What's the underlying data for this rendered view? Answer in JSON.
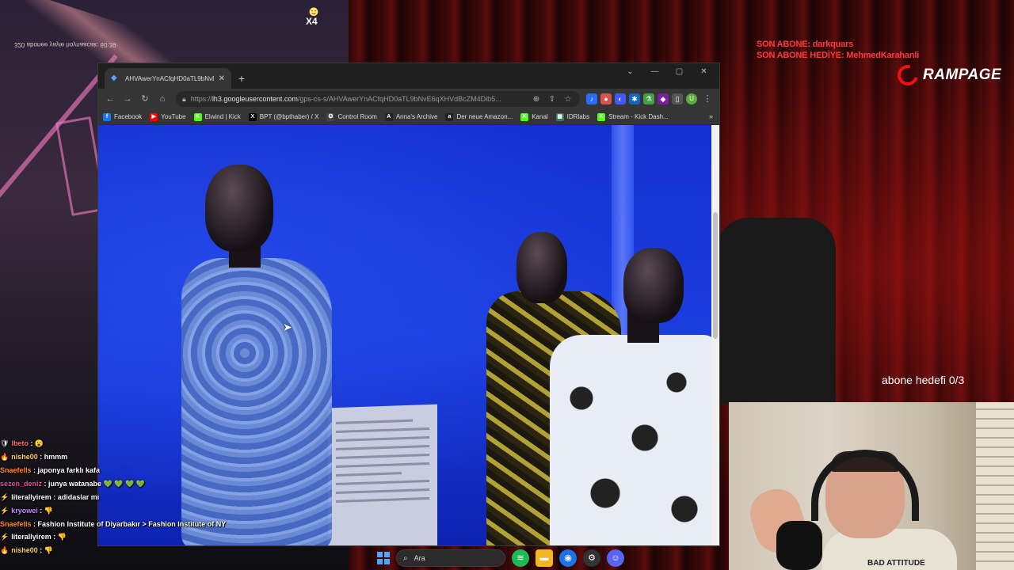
{
  "overlay": {
    "top_left_text": "320 abonee yayie hoynaacak: 60:39",
    "multiplier": "X4",
    "son_abone": "SON ABONE: darkquars",
    "son_abone_hediye": "SON ABONE HEDİYE: MehmedKarahanli",
    "brand": "RAMPAGE",
    "abone_hedefi": "abone hedefi 0/3",
    "shirt_text": "BAD ATTITUDE"
  },
  "browser": {
    "tab_title": "AHVAwerYnACfqHD0aTL9bNvE6...",
    "url_host": "lh3.googleusercontent.com",
    "url_path": "/gps-cs-s/AHVAwerYnACfqHD0aTL9bNvE6qXHVdBcZM4Dib5...",
    "url_scheme": "https://",
    "profile_initial": "U",
    "bookmarks": [
      {
        "label": "Facebook",
        "icon": "f",
        "color": "#1877f2"
      },
      {
        "label": "YouTube",
        "icon": "▶",
        "color": "#ff0000"
      },
      {
        "label": "Elwind | Kick",
        "icon": "K",
        "color": "#53fc18"
      },
      {
        "label": "BPT (@bpthaber) / X",
        "icon": "X",
        "color": "#000000"
      },
      {
        "label": "Control Room",
        "icon": "✪",
        "color": "#444444"
      },
      {
        "label": "Anna's Archive",
        "icon": "A",
        "color": "#222222"
      },
      {
        "label": "Der neue Amazon...",
        "icon": "a",
        "color": "#222222"
      },
      {
        "label": "Kanal",
        "icon": "K",
        "color": "#53fc18"
      },
      {
        "label": "IDRlabs",
        "icon": "▦",
        "color": "#3b7a57"
      },
      {
        "label": "Stream - Kick Dash...",
        "icon": "K",
        "color": "#53fc18"
      }
    ]
  },
  "chat": [
    {
      "user": "lbeto",
      "msg": " : 😮",
      "color": "#ff6f6f",
      "badge": "🛡"
    },
    {
      "user": "nishe00",
      "msg": " : hmmm",
      "color": "#ffd24a",
      "badge": "🔥"
    },
    {
      "user": "Snaefells",
      "msg": " : japonya farklı kafa",
      "color": "#ff8a1e",
      "badge": ""
    },
    {
      "user": "sezen_deniz",
      "msg": " : junya watanabe 💚 💚 💚 💚",
      "color": "#ff3ba0",
      "badge": ""
    },
    {
      "user": "literallyirem",
      "msg": " : adidaslar mı",
      "color": "#ffffff",
      "badge": "⚡"
    },
    {
      "user": "kryowei",
      "msg": " : 👎",
      "color": "#c98bff",
      "badge": "⚡"
    },
    {
      "user": "Snaefells",
      "msg": " : Fashion Institute of Diyarbakır > Fashion Institute of NY",
      "color": "#ff8a1e",
      "badge": ""
    },
    {
      "user": "literallyirem",
      "msg": " : 👎",
      "color": "#ffffff",
      "badge": "⚡"
    },
    {
      "user": "nishe00",
      "msg": " : 👎",
      "color": "#ffd24a",
      "badge": "🔥"
    }
  ],
  "taskbar": {
    "search_placeholder": "Ara"
  },
  "colors": {
    "accent_red": "#ff3a3a",
    "photo_blue": "#1d3bd6"
  }
}
